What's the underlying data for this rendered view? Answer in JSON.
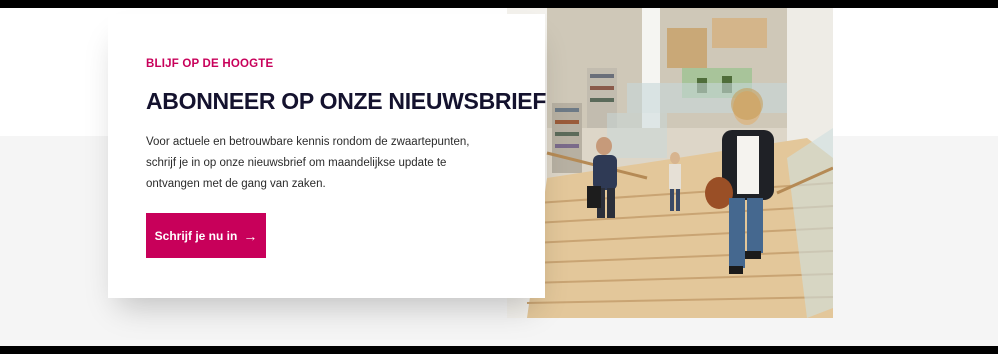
{
  "newsletter": {
    "eyebrow": "BLIJF OP DE HOOGTE",
    "title": "ABONNEER OP ONZE NIEUWSBRIEF",
    "description": "Voor actuele en betrouwbare kennis rondom de zwaartepunten, schrijf je in op onze nieuwsbrief om maandelijkse update te ontvangen met de gang van zaken.",
    "cta_label": "Schrijf je nu in",
    "cta_icon": "arrow-right-icon"
  },
  "image": {
    "subject": "library-staircase-photo"
  },
  "colors": {
    "accent": "#c8005a",
    "heading": "#14122e",
    "text": "#2b2b2b",
    "section_bg": "#f5f5f5",
    "top_bg": "#ffffff"
  }
}
